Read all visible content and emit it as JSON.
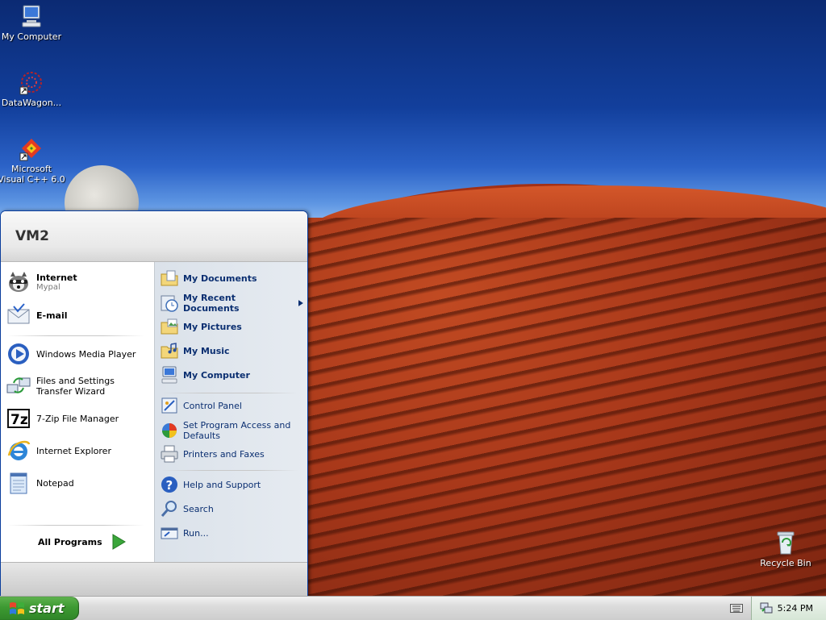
{
  "desktop": {
    "icons": [
      {
        "label": "My Computer"
      },
      {
        "label": "DataWagon..."
      },
      {
        "label": "Microsoft Visual C++ 6.0"
      },
      {
        "label": "Recycle Bin"
      }
    ]
  },
  "start_menu": {
    "user_name": "VM2",
    "pinned": [
      {
        "label": "Internet",
        "sub": "Mypal"
      },
      {
        "label": "E-mail"
      }
    ],
    "recent": [
      {
        "label": "Windows Media Player"
      },
      {
        "label": "Files and Settings Transfer Wizard"
      },
      {
        "label": "7-Zip File Manager"
      },
      {
        "label": "Internet Explorer"
      },
      {
        "label": "Notepad"
      }
    ],
    "all_programs_label": "All Programs",
    "places": [
      {
        "label": "My Documents"
      },
      {
        "label": "My Recent Documents"
      },
      {
        "label": "My Pictures"
      },
      {
        "label": "My Music"
      },
      {
        "label": "My Computer"
      }
    ],
    "settings": [
      {
        "label": "Control Panel"
      },
      {
        "label": "Set Program Access and Defaults"
      },
      {
        "label": "Printers and Faxes"
      }
    ],
    "tools": [
      {
        "label": "Help and Support"
      },
      {
        "label": "Search"
      },
      {
        "label": "Run..."
      }
    ]
  },
  "taskbar": {
    "start_label": "start",
    "clock": "5:24 PM"
  },
  "colors": {
    "start_button": "#3d9a32",
    "menu_link_text": "#0b2f71",
    "menu_border": "#0a3d9c"
  }
}
